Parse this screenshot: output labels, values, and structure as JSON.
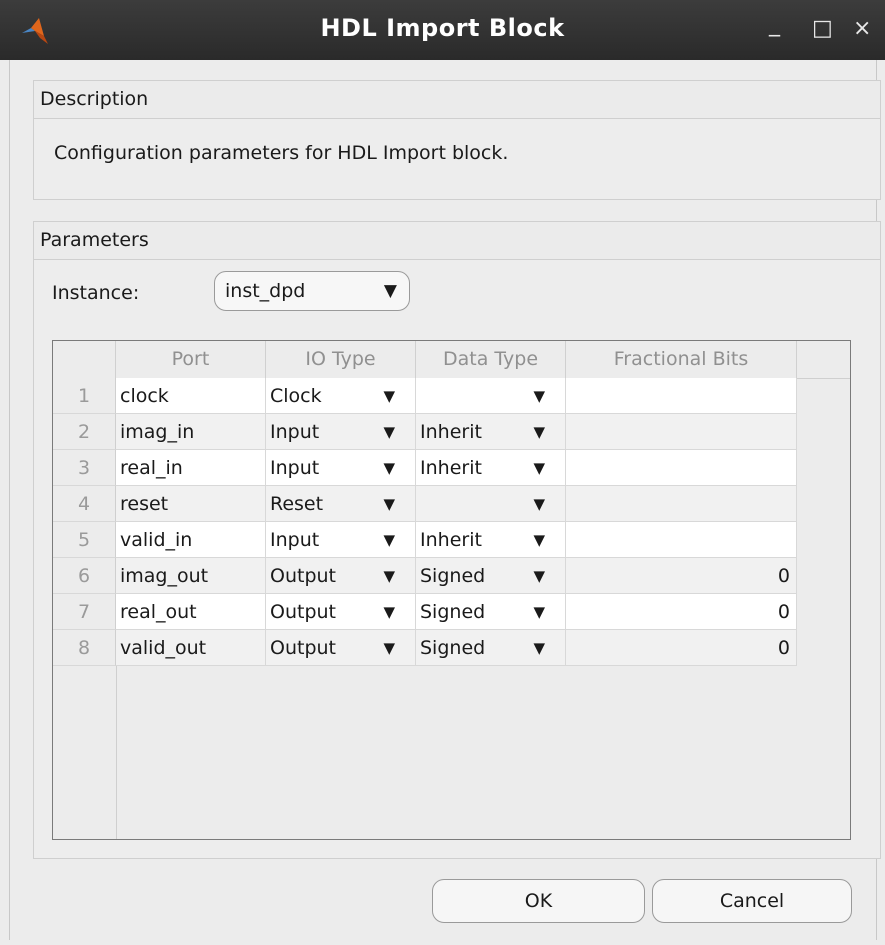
{
  "window": {
    "title": "HDL Import Block",
    "controls": {
      "minimize": "_",
      "maximize": "□",
      "close": "×"
    }
  },
  "description": {
    "header": "Description",
    "text": "Configuration parameters for HDL Import block."
  },
  "parameters": {
    "header": "Parameters",
    "instance_label": "Instance:",
    "instance_value": "inst_dpd",
    "columns": [
      "Port",
      "IO Type",
      "Data Type",
      "Fractional Bits"
    ],
    "rows": [
      {
        "num": "1",
        "port": "clock",
        "io": "Clock",
        "dtype": "",
        "frac": ""
      },
      {
        "num": "2",
        "port": "imag_in",
        "io": "Input",
        "dtype": "Inherit",
        "frac": ""
      },
      {
        "num": "3",
        "port": "real_in",
        "io": "Input",
        "dtype": "Inherit",
        "frac": ""
      },
      {
        "num": "4",
        "port": "reset",
        "io": "Reset",
        "dtype": "",
        "frac": ""
      },
      {
        "num": "5",
        "port": "valid_in",
        "io": "Input",
        "dtype": "Inherit",
        "frac": ""
      },
      {
        "num": "6",
        "port": "imag_out",
        "io": "Output",
        "dtype": "Signed",
        "frac": "0"
      },
      {
        "num": "7",
        "port": "real_out",
        "io": "Output",
        "dtype": "Signed",
        "frac": "0"
      },
      {
        "num": "8",
        "port": "valid_out",
        "io": "Output",
        "dtype": "Signed",
        "frac": "0"
      }
    ]
  },
  "buttons": {
    "ok": "OK",
    "cancel": "Cancel"
  },
  "icons": {
    "app": "matlab-logo-icon",
    "dropdown": "dropdown-arrow-icon"
  },
  "colors": {
    "titlebar": "#2f2f2f",
    "logo": "#e0661c"
  }
}
